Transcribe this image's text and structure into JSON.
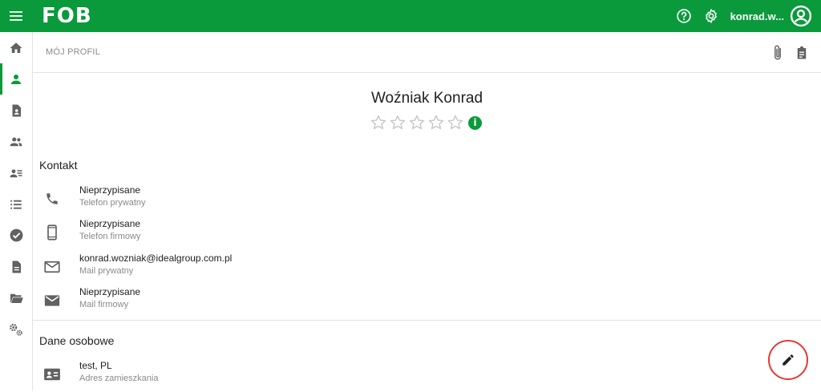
{
  "header": {
    "logo": "FOB",
    "user_name": "konrad.w...",
    "icons": [
      "menu-icon",
      "help-icon",
      "gear-icon",
      "account-circle-icon"
    ],
    "brand_color": "#0a9a3c"
  },
  "sidebar": {
    "items": [
      {
        "name": "home",
        "icon": "home-icon",
        "active": false
      },
      {
        "name": "profile",
        "icon": "person-icon",
        "active": true
      },
      {
        "name": "document-person",
        "icon": "document-person-icon",
        "active": false
      },
      {
        "name": "people",
        "icon": "people-icon",
        "active": false
      },
      {
        "name": "contacts-list",
        "icon": "contacts-list-icon",
        "active": false
      },
      {
        "name": "list",
        "icon": "list-icon",
        "active": false
      },
      {
        "name": "tasks",
        "icon": "check-circle-icon",
        "active": false
      },
      {
        "name": "documents",
        "icon": "file-icon",
        "active": false
      },
      {
        "name": "folders",
        "icon": "folder-open-icon",
        "active": false
      },
      {
        "name": "settings",
        "icon": "settings-cogs-icon",
        "active": false
      }
    ]
  },
  "breadcrumb": {
    "label": "MÓJ PROFIL",
    "icons": [
      "paperclip-icon",
      "clipboard-icon"
    ]
  },
  "profile": {
    "name": "Woźniak Konrad",
    "rating": 0,
    "rating_max": 5
  },
  "contact": {
    "title": "Kontakt",
    "rows": [
      {
        "icon": "phone-icon",
        "value": "Nieprzypisane",
        "label": "Telefon prywatny"
      },
      {
        "icon": "smartphone-icon",
        "value": "Nieprzypisane",
        "label": "Telefon firmowy"
      },
      {
        "icon": "mail-outline-icon",
        "value": "konrad.wozniak@idealgroup.com.pl",
        "label": "Mail prywatny"
      },
      {
        "icon": "mail-filled-icon",
        "value": "Nieprzypisane",
        "label": "Mail firmowy"
      }
    ]
  },
  "personal": {
    "title": "Dane osobowe",
    "rows": [
      {
        "icon": "id-card-icon",
        "value": "test, PL",
        "label": "Adres zamieszkania"
      }
    ]
  },
  "fab": {
    "icon": "pencil-icon",
    "ring_color": "#e53935"
  }
}
